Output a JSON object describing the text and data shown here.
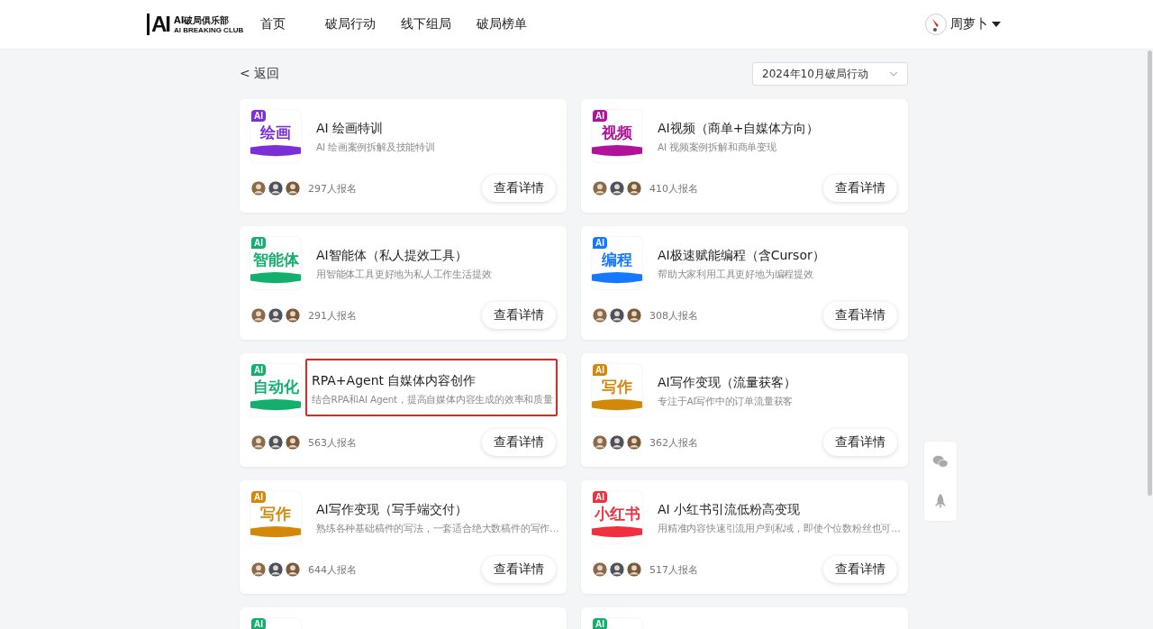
{
  "header": {
    "logo_mark": "AI",
    "logo_title": "AI破局俱乐部",
    "logo_subtitle": "AI BREAKING CLUB",
    "nav": [
      {
        "label": "首页",
        "selected": false
      },
      {
        "label": "破局行动",
        "selected": false
      },
      {
        "label": "线下组局",
        "selected": false
      },
      {
        "label": "破局榜单",
        "selected": false
      }
    ],
    "user": {
      "name": "周萝卜"
    }
  },
  "toolbar": {
    "back": "< 返回",
    "period_select": "2024年10月破局行动"
  },
  "cards": [
    {
      "badge": "AI",
      "cover_word": "绘画",
      "color": "#7a2fd8",
      "title": "AI 绘画特训",
      "description": "AI 绘画案例拆解及技能特训",
      "signups": "297人报名",
      "button": "查看详情",
      "highlighted": false
    },
    {
      "badge": "AI",
      "cover_word": "视频",
      "color": "#b1119b",
      "title": "AI视频（商单+自媒体方向）",
      "description": "AI 视频案例拆解和商单变现",
      "signups": "410人报名",
      "button": "查看详情",
      "highlighted": false
    },
    {
      "badge": "AI",
      "cover_word": "智能体",
      "color": "#13b06d",
      "title": "AI智能体（私人提效工具）",
      "description": "用智能体工具更好地为私人工作生活提效",
      "signups": "291人报名",
      "button": "查看详情",
      "highlighted": false
    },
    {
      "badge": "AI",
      "cover_word": "编程",
      "color": "#1677ff",
      "title": "AI极速赋能编程（含Cursor）",
      "description": "帮助大家利用工具更好地为编程提效",
      "signups": "308人报名",
      "button": "查看详情",
      "highlighted": false
    },
    {
      "badge": "AI",
      "cover_word": "自动化",
      "color": "#13b06d",
      "title": "RPA+Agent 自媒体内容创作",
      "description": "结合RPA和AI Agent，提高自媒体内容生成的效率和质量",
      "signups": "563人报名",
      "button": "查看详情",
      "highlighted": true
    },
    {
      "badge": "AI",
      "cover_word": "写作",
      "color": "#d4880a",
      "title": "AI写作变现（流量获客）",
      "description": "专注于AI写作中的订单流量获客",
      "signups": "362人报名",
      "button": "查看详情",
      "highlighted": false
    },
    {
      "badge": "AI",
      "cover_word": "写作",
      "color": "#d4880a",
      "title": "AI写作变现（写手端交付）",
      "description": "熟练各种基础稿件的写法，一套适合绝大数稿件的写作…",
      "signups": "644人报名",
      "button": "查看详情",
      "highlighted": false
    },
    {
      "badge": "AI",
      "cover_word": "小红书",
      "color": "#f0303f",
      "title": "AI 小红书引流低粉高变现",
      "description": "用精准内容快速引流用户到私域，即使个位数粉丝也可…",
      "signups": "517人报名",
      "button": "查看详情",
      "highlighted": false
    },
    {
      "badge": "AI",
      "color": "#13b06d"
    },
    {
      "badge": "AI",
      "color": "#13b06d"
    }
  ]
}
